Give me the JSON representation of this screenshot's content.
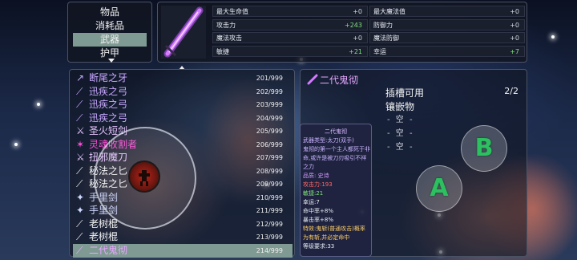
{
  "categories": {
    "items": [
      "物品",
      "消耗品",
      "武器",
      "护甲"
    ],
    "selected_index": 2
  },
  "stats": {
    "left": [
      {
        "label": "最大生命值",
        "value": "+0",
        "tone": "zero"
      },
      {
        "label": "攻击力",
        "value": "+243",
        "tone": "pos"
      },
      {
        "label": "魔法攻击",
        "value": "+0",
        "tone": "zero"
      },
      {
        "label": "敏捷",
        "value": "+21",
        "tone": "pos"
      }
    ],
    "right": [
      {
        "label": "最大魔法值",
        "value": "+0",
        "tone": "zero"
      },
      {
        "label": "防御力",
        "value": "+0",
        "tone": "zero"
      },
      {
        "label": "魔法防御",
        "value": "+0",
        "tone": "zero"
      },
      {
        "label": "幸运",
        "value": "+7",
        "tone": "pos"
      }
    ]
  },
  "inventory": [
    {
      "name": "断尾之牙",
      "count": "201/999",
      "color": "#c9a8ff",
      "icon": "claw-icon",
      "glyph": "↗"
    },
    {
      "name": "迅疾之弓",
      "count": "202/999",
      "color": "#c9a8ff",
      "icon": "bow-icon",
      "glyph": "⟋"
    },
    {
      "name": "迅疾之弓",
      "count": "203/999",
      "color": "#c9a8ff",
      "icon": "bow-icon",
      "glyph": "⟋"
    },
    {
      "name": "迅疾之弓",
      "count": "204/999",
      "color": "#c9a8ff",
      "icon": "bow-icon",
      "glyph": "⟋"
    },
    {
      "name": "圣火短剑",
      "count": "205/999",
      "color": "#e8c6ff",
      "icon": "dagger-icon",
      "glyph": "⚔"
    },
    {
      "name": "灵魂收割者",
      "count": "206/999",
      "color": "#ff4fd8",
      "icon": "scythe-icon",
      "glyph": "✶"
    },
    {
      "name": "扭邪魔刀",
      "count": "207/999",
      "color": "#e8c6ff",
      "icon": "blade-icon",
      "glyph": "⚔"
    },
    {
      "name": "秘法之匕",
      "count": "208/999",
      "color": "#f2f2f2",
      "icon": "knife-icon",
      "glyph": "⟋"
    },
    {
      "name": "秘法之匕",
      "count": "209/999",
      "color": "#f2f2f2",
      "icon": "knife-icon",
      "glyph": "⟋"
    },
    {
      "name": "手里剑",
      "count": "210/999",
      "color": "#cfd8ff",
      "icon": "shuriken-icon",
      "glyph": "✦"
    },
    {
      "name": "手里剑",
      "count": "211/999",
      "color": "#cfd8ff",
      "icon": "shuriken-icon",
      "glyph": "✦"
    },
    {
      "name": "老树棍",
      "count": "212/999",
      "color": "#f2f2f2",
      "icon": "staff-icon",
      "glyph": "⟋"
    },
    {
      "name": "老树棍",
      "count": "213/999",
      "color": "#f2f2f2",
      "icon": "staff-icon",
      "glyph": "⟋"
    },
    {
      "name": "二代鬼彻",
      "count": "214/999",
      "color": "#e6a8ff",
      "icon": "sword-icon",
      "glyph": "⟋"
    }
  ],
  "selected_item_index": 13,
  "detail": {
    "name": "二代鬼彻",
    "slot_title": "插槽可用",
    "slot_subtitle": "镶嵌物",
    "page": "2/2",
    "empty_slots": [
      "- 空 -",
      "- 空 -",
      "- 空 -"
    ]
  },
  "tooltip": {
    "title": "二代鬼彻",
    "lines": [
      {
        "text": "武器类型:太刀(双手)",
        "color": "#c9b3ff"
      },
      {
        "text": "鬼彻的第一个主人都死于非",
        "color": "#c9b3ff"
      },
      {
        "text": "命,或许是被刀刃吸引不祥",
        "color": "#c9b3ff"
      },
      {
        "text": "之力",
        "color": "#c9b3ff"
      },
      {
        "text": "品质: 史诗",
        "color": "#d59cff"
      },
      {
        "text": "攻击力:193",
        "color": "#ff6a6a"
      },
      {
        "text": "敏捷:21",
        "color": "#7fe07a"
      },
      {
        "text": "幸运:7",
        "color": "#e8ecf4"
      },
      {
        "text": "命中率+8%",
        "color": "#e8ecf4"
      },
      {
        "text": "暴击率+8%",
        "color": "#e8ecf4"
      },
      {
        "text": "特效:鬼斩(普通攻击)概率",
        "color": "#ffcf6a"
      },
      {
        "text": "为有斩,并必定命中",
        "color": "#ffcf6a"
      },
      {
        "text": "等级要求:33",
        "color": "#e8ecf4"
      }
    ]
  },
  "controls": {
    "button_a": "A",
    "button_b": "B"
  },
  "colors": {
    "selected_row": "#7f9a92",
    "positive_stat": "#7fe07a",
    "epic_item": "#e6a8ff",
    "legendary_item": "#ff4fd8"
  }
}
